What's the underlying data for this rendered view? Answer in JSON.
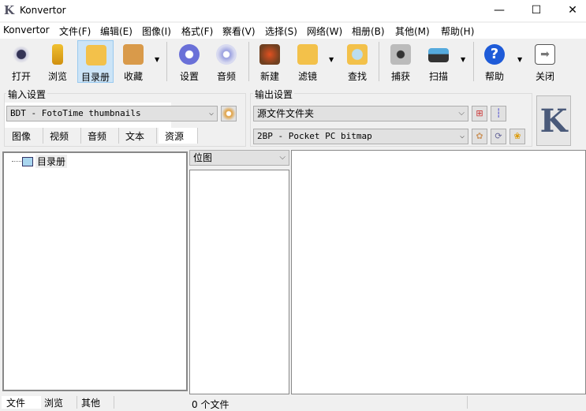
{
  "window": {
    "title": "Konvertor",
    "logo": "K",
    "minimize": "—",
    "maximize": "☐",
    "close": "✕"
  },
  "menu": [
    "Konvertor",
    "文件(F)",
    "编辑(E)",
    "图像(I)",
    "格式(F)",
    "察看(V)",
    "选择(S)",
    "网络(W)",
    "相册(B)",
    "其他(M)",
    "帮助(H)"
  ],
  "toolbar": {
    "open": "打开",
    "browse": "浏览",
    "catalog": "目录册",
    "favorites": "收藏",
    "settings": "设置",
    "audio": "音频",
    "new": "新建",
    "filters": "滤镜",
    "find": "查找",
    "capture": "捕获",
    "scan": "扫描",
    "help": "帮助",
    "close": "关闭",
    "dropdown": "▼"
  },
  "input_settings": {
    "label": "输入设置",
    "format": "BDT - FotoTime thumbnails",
    "tabs": [
      "图像",
      "视频",
      "音频",
      "文本",
      "资源"
    ]
  },
  "output_settings": {
    "label": "输出设置",
    "folder": "源文件文件夹",
    "format": "2BP - Pocket PC bitmap"
  },
  "tree": {
    "root": "目录册"
  },
  "filter": {
    "value": "位图"
  },
  "bottom_tabs": [
    "文件",
    "浏览",
    "其他"
  ],
  "status": {
    "count": "0 个文件"
  },
  "colors": {
    "active_bg": "#cce4f7",
    "help_blue": "#1e5bd8"
  }
}
